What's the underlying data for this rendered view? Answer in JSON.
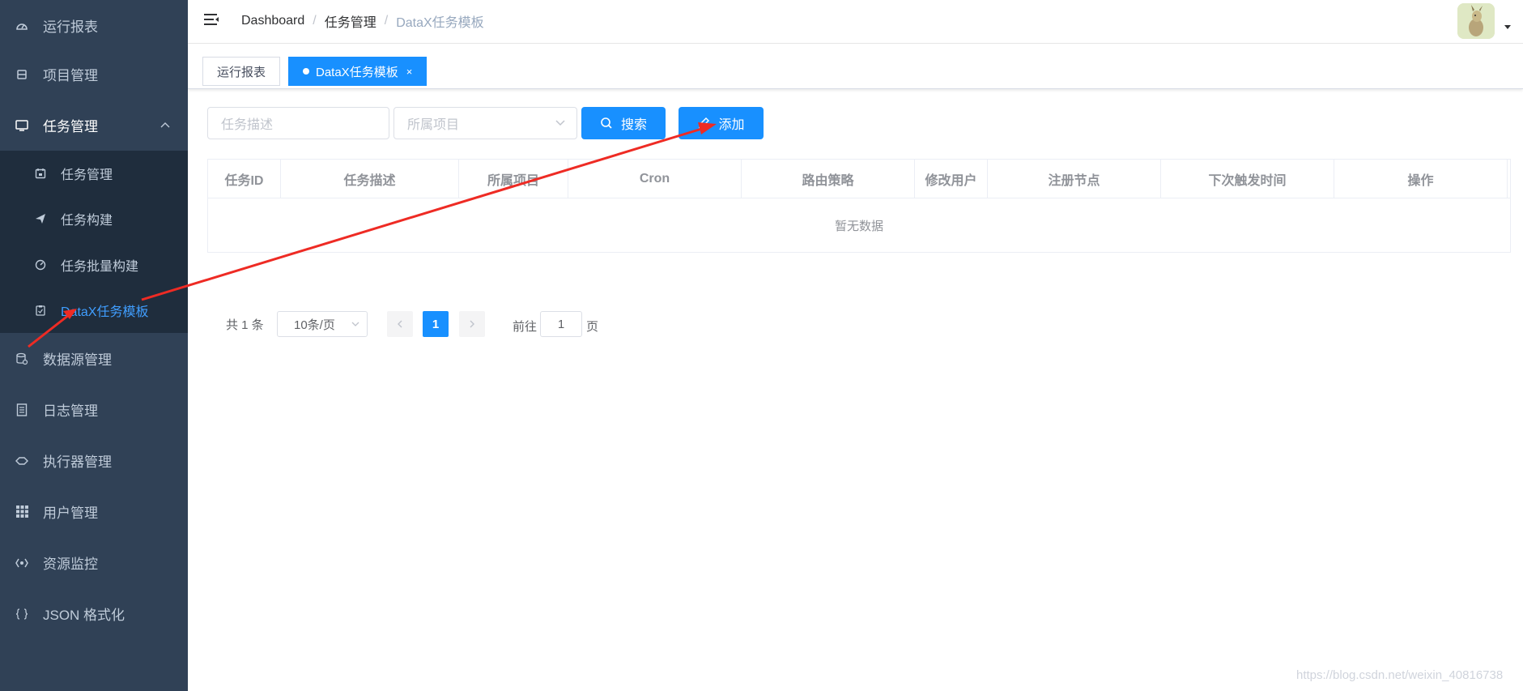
{
  "sidebar": {
    "items": [
      {
        "label": "运行报表",
        "icon": "dashboard-icon"
      },
      {
        "label": "项目管理",
        "icon": "project-icon"
      },
      {
        "label": "任务管理",
        "icon": "monitor-icon",
        "expanded": true
      },
      {
        "label": "数据源管理",
        "icon": "database-icon"
      },
      {
        "label": "日志管理",
        "icon": "document-icon"
      },
      {
        "label": "执行器管理",
        "icon": "executor-icon"
      },
      {
        "label": "用户管理",
        "icon": "grid-icon"
      },
      {
        "label": "资源监控",
        "icon": "monitor-resource-icon"
      },
      {
        "label": "JSON 格式化",
        "icon": "braces-icon"
      }
    ],
    "submenu": [
      {
        "label": "任务管理",
        "icon": "calendar-icon"
      },
      {
        "label": "任务构建",
        "icon": "paper-plane-icon"
      },
      {
        "label": "任务批量构建",
        "icon": "gauge-icon"
      },
      {
        "label": "DataX任务模板",
        "icon": "clipboard-icon",
        "active": true
      }
    ]
  },
  "navbar": {
    "breadcrumb": [
      "Dashboard",
      "任务管理",
      "DataX任务模板"
    ]
  },
  "tags": [
    {
      "label": "运行报表",
      "active": false
    },
    {
      "label": "DataX任务模板",
      "active": true,
      "close": "×"
    }
  ],
  "filters": {
    "desc_placeholder": "任务描述",
    "project_placeholder": "所属项目",
    "search_label": "搜索",
    "add_label": "添加"
  },
  "table": {
    "columns": [
      "任务ID",
      "任务描述",
      "所属项目",
      "Cron",
      "路由策略",
      "修改用户",
      "注册节点",
      "下次触发时间",
      "操作"
    ],
    "empty_text": "暂无数据"
  },
  "pagination": {
    "total": "共 1 条",
    "page_size": "10条/页",
    "current_page": "1",
    "goto_prefix": "前往",
    "goto_value": "1",
    "goto_suffix": "页"
  },
  "watermark": "https://blog.csdn.net/weixin_40816738",
  "colors": {
    "sidebar_bg": "#304156",
    "submenu_bg": "#1f2d3d",
    "accent": "#1890ff",
    "active_text": "#409eff",
    "annotation_arrow": "#ee2b24"
  }
}
